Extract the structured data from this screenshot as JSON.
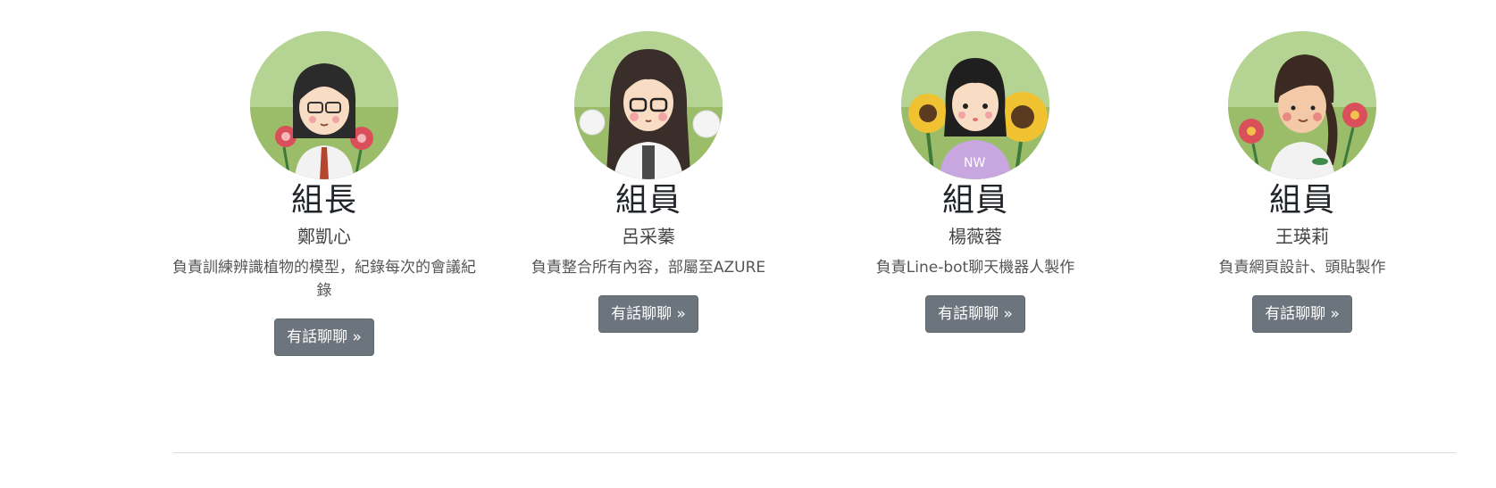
{
  "members": [
    {
      "role": "組長",
      "name": "鄭凱心",
      "desc": "負責訓練辨識植物的模型，紀錄每次的會議紀錄",
      "button": "有話聊聊 »"
    },
    {
      "role": "組員",
      "name": "呂采蓁",
      "desc": "負責整合所有內容，部屬至AZURE",
      "button": "有話聊聊 »"
    },
    {
      "role": "組員",
      "name": "楊薇蓉",
      "desc": "負責Line-bot聊天機器人製作",
      "button": "有話聊聊 »"
    },
    {
      "role": "組員",
      "name": "王瑛莉",
      "desc": "負責網頁設計、頭貼製作",
      "button": "有話聊聊 »"
    }
  ],
  "colors": {
    "button_bg": "#6c757d",
    "avatar_sky": "#b5d493",
    "avatar_grass": "#9bbd6a"
  },
  "icons": [
    "avatar-illustration"
  ],
  "nw_badge": "NW"
}
